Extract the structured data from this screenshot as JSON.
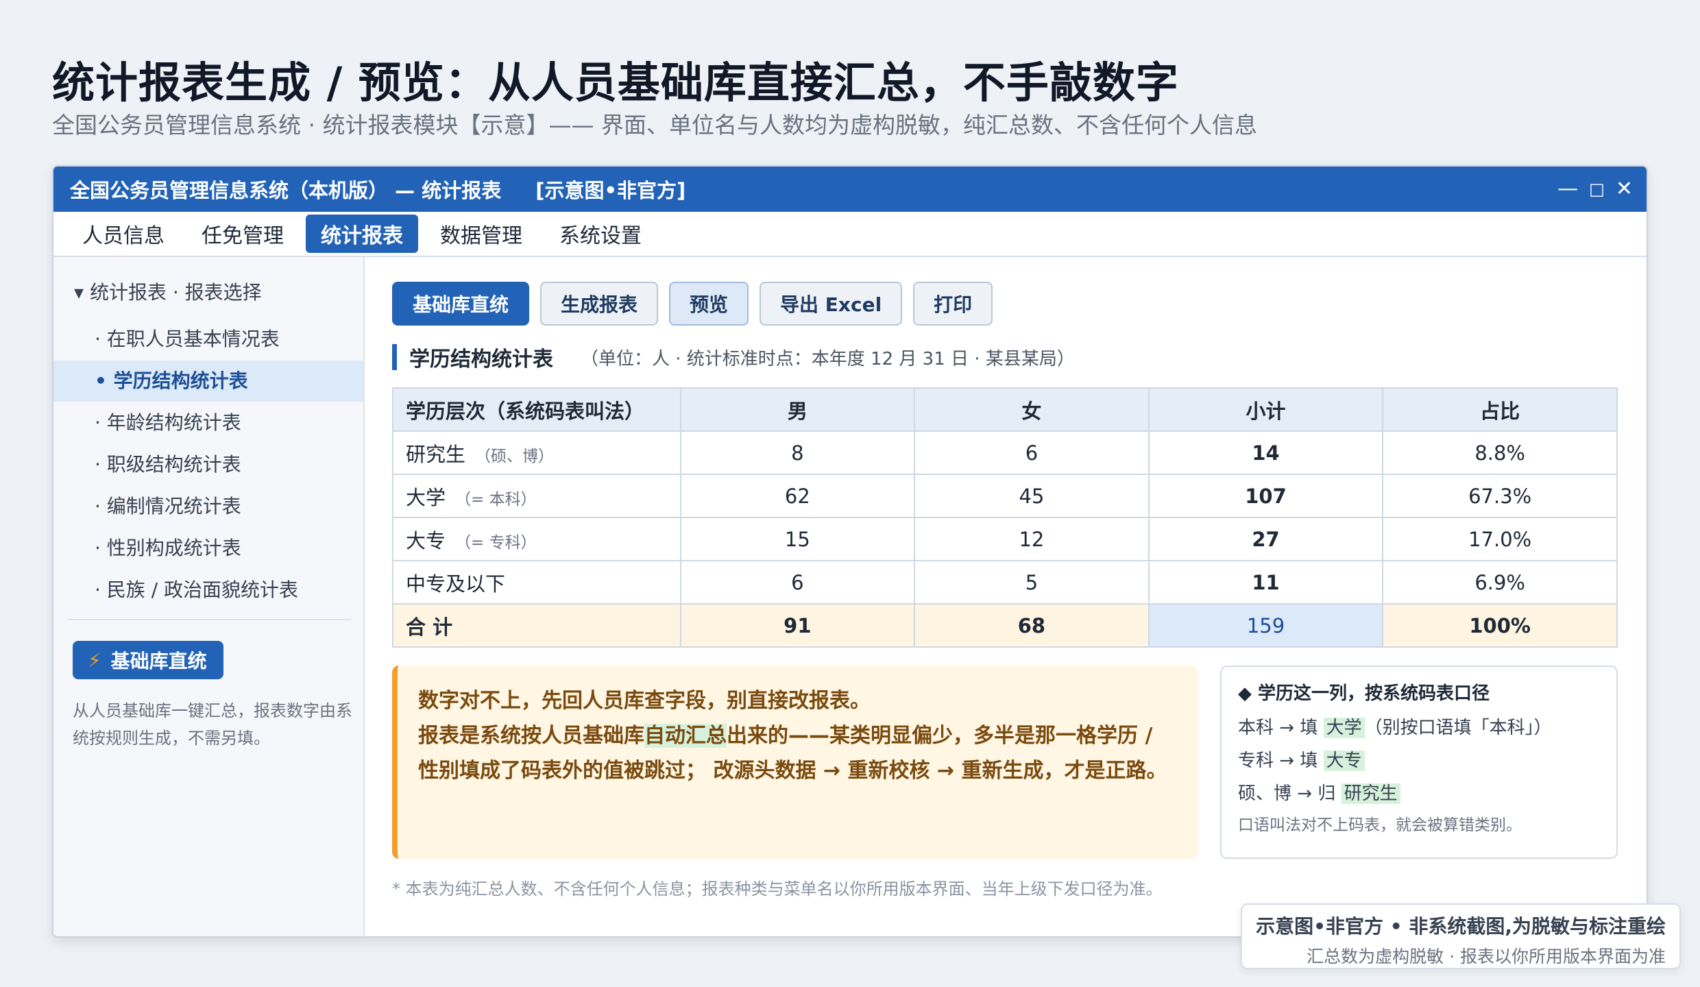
{
  "page": {
    "title": "统计报表生成 / 预览：从人员基础库直接汇总，不手敲数字",
    "subtitle": "全国公务员管理信息系统 · 统计报表模块【示意】—— 界面、单位名与人数均为虚构脱敏，纯汇总数、不含任何个人信息"
  },
  "window": {
    "title": "全国公务员管理信息系统（本机版） — 统计报表",
    "tag": "[示意图•非官方]",
    "controls": {
      "minimize": "—",
      "maximize": "□",
      "close": "✕"
    }
  },
  "menu": [
    "人员信息",
    "任免管理",
    "统计报表",
    "数据管理",
    "系统设置"
  ],
  "sidebar": {
    "head": "▾  统计报表 · 报表选择",
    "items": [
      "· 在职人员基本情况表",
      "• 学历结构统计表",
      "· 年龄结构统计表",
      "· 职级结构统计表",
      "· 编制情况统计表",
      "· 性别构成统计表",
      "· 民族 / 政治面貌统计表"
    ],
    "button": "基础库直统",
    "note": "从人员基础库一键汇总，报表数字由系统按规则生成，不需另填。"
  },
  "toolbar": [
    "基础库直统",
    "生成报表",
    "预览",
    "导出 Excel",
    "打印"
  ],
  "section": {
    "name": "学历结构统计表",
    "meta": "（单位：人 · 统计标准时点：本年度 12 月 31 日 · 某县某局）"
  },
  "table": {
    "headers": [
      "学历层次（系统码表叫法）",
      "男",
      "女",
      "小计",
      "占比"
    ],
    "rows": [
      {
        "level": "研究生",
        "note": "（硕、博）",
        "male": "8",
        "female": "6",
        "subtotal": "14",
        "ratio": "8.8%"
      },
      {
        "level": "大学",
        "note": "（= 本科）",
        "male": "62",
        "female": "45",
        "subtotal": "107",
        "ratio": "67.3%"
      },
      {
        "level": "大专",
        "note": "（= 专科）",
        "male": "15",
        "female": "12",
        "subtotal": "27",
        "ratio": "17.0%"
      },
      {
        "level": "中专及以下",
        "note": "",
        "male": "6",
        "female": "5",
        "subtotal": "11",
        "ratio": "6.9%"
      }
    ],
    "total": {
      "label": "合  计",
      "male": "91",
      "female": "68",
      "subtotal": "159",
      "ratio": "100%"
    }
  },
  "callout": {
    "line1": "数字对不上，先回人员库查字段，别直接改报表。",
    "line2_pre": "报表是系统按人员基础库",
    "line2_hl": "自动汇总",
    "line2_post": "出来的——某类明显偏少，多半是那一格学历 /",
    "line3": "性别填成了码表外的值被跳过； 改源头数据 → 重新校核 → 重新生成，才是正路。"
  },
  "infobox": {
    "title": "◆ 学历这一列，按系统码表口径",
    "l1_pre": "本科 → 填 ",
    "l1_hl": "大学",
    "l1_post": "（别按口语填「本科」）",
    "l2_pre": "专科 → 填 ",
    "l2_hl": "大专",
    "l3_pre": "硕、博 → 归 ",
    "l3_hl": "研究生",
    "note": "口语叫法对不上码表，就会被算错类别。"
  },
  "footnote": "* 本表为纯汇总人数、不含任何个人信息；报表种类与菜单名以你所用版本界面、当年上级下发口径为准。",
  "watermark": {
    "main": "示意图•非官方 • 非系统截图,为脱敏与标注重绘",
    "sub": "汇总数为虚构脱敏 · 报表以你所用版本界面为准"
  }
}
